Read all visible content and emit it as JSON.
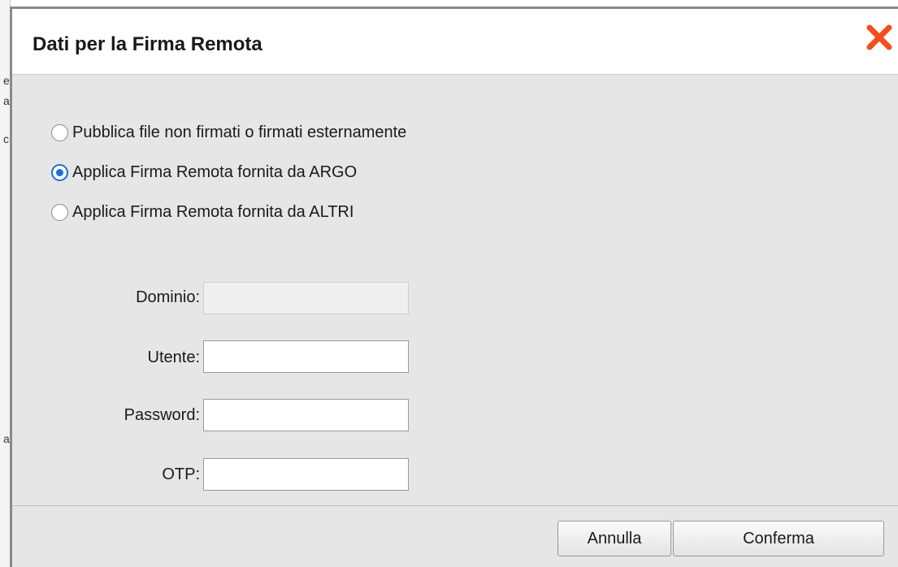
{
  "dialog": {
    "title": "Dati per la Firma Remota",
    "close_icon": "close-icon",
    "accent_color": "#1d6fd6",
    "close_color": "#f0501f"
  },
  "background": {
    "strip_chars": [
      "e",
      "a",
      "c",
      "a"
    ]
  },
  "signature_options": [
    {
      "label": "Pubblica file non firmati o firmati esternamente",
      "checked": false
    },
    {
      "label": "Applica Firma Remota fornita da ARGO",
      "checked": true
    },
    {
      "label": "Applica Firma Remota fornita da ALTRI",
      "checked": false
    }
  ],
  "fields": {
    "dominio": {
      "label": "Dominio:",
      "value": "",
      "disabled": true
    },
    "utente": {
      "label": "Utente:",
      "value": "",
      "disabled": false
    },
    "password": {
      "label": "Password:",
      "value": "",
      "disabled": false
    },
    "otp": {
      "label": "OTP:",
      "value": "",
      "disabled": false
    }
  },
  "footer": {
    "cancel_label": "Annulla",
    "confirm_label": "Conferma"
  }
}
